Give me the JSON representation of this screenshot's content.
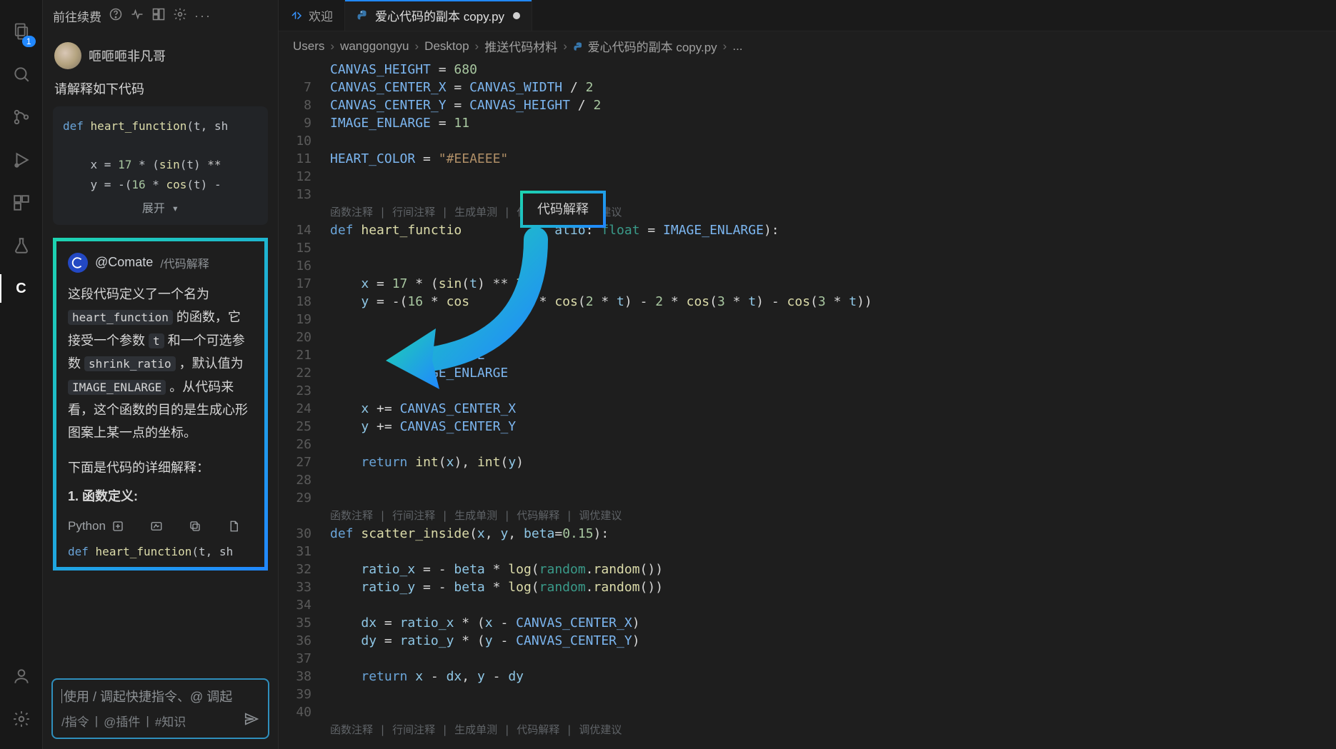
{
  "activity_bar": {
    "explorer_badge": "1"
  },
  "side_header": {
    "title": "前往续费"
  },
  "chat": {
    "user_name": "咂咂咂非凡哥",
    "user_prompt": "请解释如下代码",
    "code_snip_line1": "def heart_function(t, sh",
    "code_snip_line2": "    x = 17 * (sin(t) **",
    "code_snip_line3": "    y = -(16 * cos(t) -",
    "expand_label": "展开 ▾"
  },
  "comate": {
    "name": "@Comate",
    "tag": "/代码解释",
    "body_parts": {
      "p1": "这段代码定义了一个名为",
      "chip1": "heart_function",
      "p2": " 的函数，它接受一个参数 ",
      "chip2": "t",
      "p3": " 和一个可选参数 ",
      "chip3": "shrink_ratio",
      "p4": "，默认值为",
      "chip4": "IMAGE_ENLARGE",
      "p5": "。从代码来看，这个函数的目的是生成心形图案上某一点的坐标。"
    },
    "sub": "下面是代码的详细解释：",
    "list_1": "1. 函数定义:",
    "toolbar": {
      "lang": "Python"
    },
    "code2": "def heart_function(t, sh"
  },
  "input_box": {
    "placeholder_line1": "使用 / 调起快捷指令、@ 调起",
    "hints": {
      "h1": "/指令",
      "sep1": "|",
      "h2": "@插件",
      "sep2": "|",
      "h3": "#知识"
    }
  },
  "tabs": [
    {
      "label": "欢迎",
      "kind": "welcome",
      "active": false
    },
    {
      "label": "爱心代码的副本 copy.py",
      "kind": "python",
      "active": true,
      "modified": true
    }
  ],
  "breadcrumb": [
    "Users",
    "wanggongyu",
    "Desktop",
    "推送代码材料",
    "爱心代码的副本 copy.py",
    "..."
  ],
  "codelens_items": [
    "函数注释",
    "行间注释",
    "生成单测",
    "代码解释",
    "调优建议"
  ],
  "highlight_label": "代码解释",
  "editor": {
    "lines": [
      {
        "n": "",
        "html": "<span class='tok-var'>CANVAS_HEIGHT</span> = <span class='tok-num'>680</span>"
      },
      {
        "n": "7",
        "html": "<span class='tok-var'>CANVAS_CENTER_X</span> = <span class='tok-var'>CANVAS_WIDTH</span> / <span class='tok-num'>2</span>"
      },
      {
        "n": "8",
        "html": "<span class='tok-var'>CANVAS_CENTER_Y</span> = <span class='tok-var'>CANVAS_HEIGHT</span> / <span class='tok-num'>2</span>"
      },
      {
        "n": "9",
        "html": "<span class='tok-var'>IMAGE_ENLARGE</span> = <span class='tok-num'>11</span>"
      },
      {
        "n": "10",
        "html": ""
      },
      {
        "n": "11",
        "html": "<span class='tok-var'>HEART_COLOR</span> = <span class='tok-str'>\"#EEAEEE\"</span>"
      },
      {
        "n": "12",
        "html": ""
      },
      {
        "n": "13",
        "html": ""
      },
      {
        "n": "",
        "html": "",
        "codelens": true
      },
      {
        "n": "14",
        "html": "<span class='tok-kw'>def</span> <span class='tok-def'>heart_functio</span>            <span class='tok-param'>atio</span>: <span class='tok-type'>float</span> = <span class='tok-var'>IMAGE_ENLARGE</span>):"
      },
      {
        "n": "15",
        "html": ""
      },
      {
        "n": "16",
        "html": ""
      },
      {
        "n": "17",
        "html": "    <span class='tok-param'>x</span> = <span class='tok-num'>17</span> * (<span class='tok-fn'>sin</span>(<span class='tok-param'>t</span>)<span class='tok-op'> ** </span><span class='tok-num'>3</span>)"
      },
      {
        "n": "18",
        "html": "    <span class='tok-param'>y</span> = -(<span class='tok-num'>16</span> * <span class='tok-fn'>cos</span>     - <span class='tok-num'>5</span> * <span class='tok-fn'>cos</span>(<span class='tok-num'>2</span> * <span class='tok-param'>t</span>) - <span class='tok-num'>2</span> * <span class='tok-fn'>cos</span>(<span class='tok-num'>3</span> * <span class='tok-param'>t</span>) - <span class='tok-fn'>cos</span>(<span class='tok-num'>3</span> * <span class='tok-param'>t</span>))"
      },
      {
        "n": "19",
        "html": ""
      },
      {
        "n": "20",
        "html": ""
      },
      {
        "n": "21",
        "html": "              <span class='tok-var'>NLARGE</span>"
      },
      {
        "n": "22",
        "html": "            <span class='tok-var'>AGE_ENLARGE</span>"
      },
      {
        "n": "23",
        "html": ""
      },
      {
        "n": "24",
        "html": "    <span class='tok-param'>x</span> += <span class='tok-var'>CANVAS_CENTER_X</span>"
      },
      {
        "n": "25",
        "html": "    <span class='tok-param'>y</span> += <span class='tok-var'>CANVAS_CENTER_Y</span>"
      },
      {
        "n": "26",
        "html": ""
      },
      {
        "n": "27",
        "html": "    <span class='tok-kw'>return</span> <span class='tok-fn'>int</span>(<span class='tok-param'>x</span>), <span class='tok-fn'>int</span>(<span class='tok-param'>y</span>)"
      },
      {
        "n": "28",
        "html": ""
      },
      {
        "n": "29",
        "html": ""
      },
      {
        "n": "",
        "html": "",
        "codelens": true
      },
      {
        "n": "30",
        "html": "<span class='tok-kw'>def</span> <span class='tok-def'>scatter_inside</span>(<span class='tok-param'>x</span>, <span class='tok-param'>y</span>, <span class='tok-param'>beta</span>=<span class='tok-num'>0.15</span>):"
      },
      {
        "n": "31",
        "html": ""
      },
      {
        "n": "32",
        "html": "    <span class='tok-param'>ratio_x</span> = - <span class='tok-param'>beta</span> * <span class='tok-fn'>log</span>(<span class='tok-mod'>random</span>.<span class='tok-fn'>random</span>())"
      },
      {
        "n": "33",
        "html": "    <span class='tok-param'>ratio_y</span> = - <span class='tok-param'>beta</span> * <span class='tok-fn'>log</span>(<span class='tok-mod'>random</span>.<span class='tok-fn'>random</span>())"
      },
      {
        "n": "34",
        "html": ""
      },
      {
        "n": "35",
        "html": "    <span class='tok-param'>dx</span> = <span class='tok-param'>ratio_x</span> * (<span class='tok-param'>x</span> - <span class='tok-var'>CANVAS_CENTER_X</span>)"
      },
      {
        "n": "36",
        "html": "    <span class='tok-param'>dy</span> = <span class='tok-param'>ratio_y</span> * (<span class='tok-param'>y</span> - <span class='tok-var'>CANVAS_CENTER_Y</span>)"
      },
      {
        "n": "37",
        "html": ""
      },
      {
        "n": "38",
        "html": "    <span class='tok-kw'>return</span> <span class='tok-param'>x</span> - <span class='tok-param'>dx</span>, <span class='tok-param'>y</span> - <span class='tok-param'>dy</span>"
      },
      {
        "n": "39",
        "html": ""
      },
      {
        "n": "40",
        "html": ""
      },
      {
        "n": "",
        "html": "",
        "codelens": true
      }
    ]
  }
}
